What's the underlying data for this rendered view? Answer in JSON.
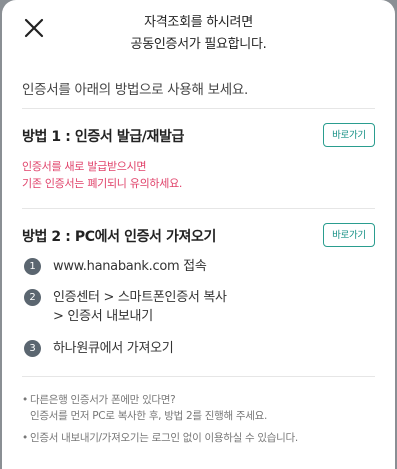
{
  "header": {
    "title_line1": "자격조회를 하시려면",
    "title_line2": "공동인증서가 필요합니다."
  },
  "intro": "인증서를 아래의 방법으로 사용해 보세요.",
  "method1": {
    "title": "방법 1 : 인증서 발급/재발급",
    "button_label": "바로가기",
    "warning_line1": "인증서를 새로 발급받으시면",
    "warning_line2": "기존 인증서는 폐기되니 유의하세요."
  },
  "method2": {
    "title": "방법 2 : PC에서 인증서 가져오기",
    "button_label": "바로가기",
    "steps": [
      {
        "num": "1",
        "line1": "www.hanabank.com 접속",
        "line2": ""
      },
      {
        "num": "2",
        "line1": "인증센터 > 스마트폰인증서 복사",
        "line2": "> 인증서 내보내기"
      },
      {
        "num": "3",
        "line1": "하나원큐에서 가져오기",
        "line2": ""
      }
    ]
  },
  "notes": {
    "bullet": "•",
    "note1_line1": "다른은행 인증서가 폰에만 있다면?",
    "note1_line2": "인증서를 먼저 PC로 복사한 후, 방법 2를 진행해 주세요.",
    "note2": "인증서 내보내기/가져오기는 로그인 없이 이용하실 수 있습니다."
  },
  "colors": {
    "accent": "#138f84",
    "warning": "#e0426a",
    "step_badge": "#5b6670"
  },
  "icons": {
    "close": "close-icon"
  }
}
